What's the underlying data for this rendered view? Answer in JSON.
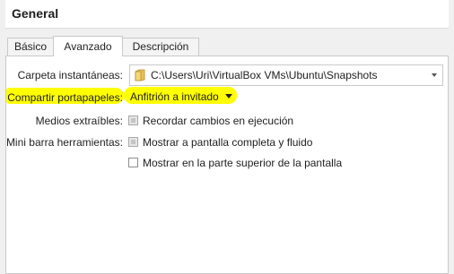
{
  "header": {
    "title": "General"
  },
  "tabs": [
    {
      "label": "Básico",
      "active": false
    },
    {
      "label": "Avanzado",
      "active": true
    },
    {
      "label": "Descripción",
      "active": false
    }
  ],
  "advanced": {
    "snapshot_folder": {
      "label": "Carpeta instantáneas:",
      "value": "C:\\Users\\Uri\\VirtualBox VMs\\Ubuntu\\Snapshots",
      "icon": "folder-icon"
    },
    "shared_clipboard": {
      "label": "Compartir portapapeles:",
      "value": "Anfitrión a invitado",
      "highlight_color": "#ffff00"
    },
    "removable_media": {
      "label": "Medios extraíbles:",
      "checkbox_label": "Recordar cambios en ejecución",
      "state": "disabled"
    },
    "mini_toolbar": {
      "label": "Mini barra herramientas:",
      "options": [
        {
          "label": "Mostrar a pantalla completa y fluido",
          "state": "disabled"
        },
        {
          "label": "Mostrar en la parte superior de la pantalla",
          "state": "unchecked"
        }
      ]
    }
  },
  "colors": {
    "background": "#f0f0f0",
    "panel": "#ffffff",
    "highlight": "#ffff00"
  }
}
